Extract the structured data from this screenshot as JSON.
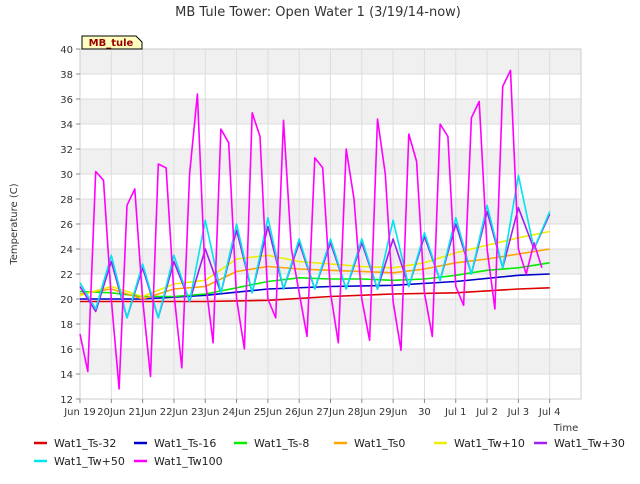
{
  "chart_data": {
    "type": "line",
    "title": "MB Tule Tower: Open Water 1 (3/19/14-now)",
    "xlabel": "Time",
    "ylabel": "Temperature (C)",
    "site_label": "MB_tule",
    "xlim": [
      "2014-06-18T12:00",
      "2014-07-04T12:00"
    ],
    "ylim": [
      12,
      40
    ],
    "yticks": [
      12,
      14,
      16,
      18,
      20,
      22,
      24,
      26,
      28,
      30,
      32,
      34,
      36,
      38,
      40
    ],
    "xticks": [
      {
        "date": "2014-06-18T12:00",
        "label": "Jun 19"
      },
      {
        "date": "2014-06-19T12:00",
        "label": "20Jun"
      },
      {
        "date": "2014-06-20T12:00",
        "label": "21Jun"
      },
      {
        "date": "2014-06-21T12:00",
        "label": "22Jun"
      },
      {
        "date": "2014-06-22T12:00",
        "label": "23Jun"
      },
      {
        "date": "2014-06-23T12:00",
        "label": "24Jun"
      },
      {
        "date": "2014-06-24T12:00",
        "label": "25Jun"
      },
      {
        "date": "2014-06-25T12:00",
        "label": "26Jun"
      },
      {
        "date": "2014-06-26T12:00",
        "label": "27Jun"
      },
      {
        "date": "2014-06-27T12:00",
        "label": "28Jun"
      },
      {
        "date": "2014-06-28T12:00",
        "label": "29Jun"
      },
      {
        "date": "2014-06-29T12:00",
        "label": "30"
      },
      {
        "date": "2014-06-30T12:00",
        "label": "Jul 1"
      },
      {
        "date": "2014-07-01T12:00",
        "label": "Jul 2"
      },
      {
        "date": "2014-07-02T12:00",
        "label": "Jul 3"
      },
      {
        "date": "2014-07-03T12:00",
        "label": "Jul 4"
      }
    ],
    "grid": true,
    "band_fill": "#f0f0f0",
    "legend_position": "bottom",
    "series": [
      {
        "name": "Wat1_Ts-32",
        "color": "#dd0000",
        "x": [
          "2014-06-18T12:00",
          "2014-06-20T12:00",
          "2014-06-22T12:00",
          "2014-06-24T12:00",
          "2014-06-26T12:00",
          "2014-06-28T12:00",
          "2014-06-30T12:00",
          "2014-07-02T12:00",
          "2014-07-03T12:00"
        ],
        "y": [
          19.8,
          19.8,
          19.8,
          19.9,
          20.2,
          20.4,
          20.5,
          20.8,
          20.9
        ]
      },
      {
        "name": "Wat1_Ts-16",
        "color": "#0000cc",
        "x": [
          "2014-06-18T12:00",
          "2014-06-20T12:00",
          "2014-06-22T12:00",
          "2014-06-24T12:00",
          "2014-06-26T12:00",
          "2014-06-28T12:00",
          "2014-06-30T12:00",
          "2014-07-02T12:00",
          "2014-07-03T12:00"
        ],
        "y": [
          20.0,
          20.0,
          20.3,
          20.8,
          21.0,
          21.1,
          21.4,
          21.9,
          22.0
        ]
      },
      {
        "name": "Wat1_Ts-8",
        "color": "#00ee00",
        "x": [
          "2014-06-18T12:00",
          "2014-06-19T12:00",
          "2014-06-20T12:00",
          "2014-06-21T12:00",
          "2014-06-22T12:00",
          "2014-06-23T12:00",
          "2014-06-24T12:00",
          "2014-06-25T12:00",
          "2014-06-26T12:00",
          "2014-06-27T12:00",
          "2014-06-28T12:00",
          "2014-06-29T12:00",
          "2014-06-30T12:00",
          "2014-07-01T12:00",
          "2014-07-02T12:00",
          "2014-07-03T12:00"
        ],
        "y": [
          20.6,
          20.5,
          20.2,
          20.2,
          20.4,
          20.9,
          21.4,
          21.7,
          21.6,
          21.6,
          21.5,
          21.6,
          21.9,
          22.3,
          22.5,
          22.9
        ]
      },
      {
        "name": "Wat1_Ts0",
        "color": "#ffa500",
        "x": [
          "2014-06-18T12:00",
          "2014-06-19T12:00",
          "2014-06-20T12:00",
          "2014-06-21T12:00",
          "2014-06-22T12:00",
          "2014-06-23T12:00",
          "2014-06-24T12:00",
          "2014-06-25T12:00",
          "2014-06-26T12:00",
          "2014-06-27T12:00",
          "2014-06-28T12:00",
          "2014-06-29T12:00",
          "2014-06-30T12:00",
          "2014-07-01T12:00",
          "2014-07-02T12:00",
          "2014-07-03T12:00"
        ],
        "y": [
          20.4,
          20.8,
          20.0,
          20.8,
          21.0,
          22.2,
          22.6,
          22.4,
          22.3,
          22.2,
          22.1,
          22.4,
          22.9,
          23.2,
          23.6,
          24.0
        ]
      },
      {
        "name": "Wat1_Tw+10",
        "color": "#eeee00",
        "x": [
          "2014-06-18T12:00",
          "2014-06-19T12:00",
          "2014-06-20T12:00",
          "2014-06-21T12:00",
          "2014-06-22T12:00",
          "2014-06-23T12:00",
          "2014-06-24T12:00",
          "2014-06-25T12:00",
          "2014-06-26T12:00",
          "2014-06-27T12:00",
          "2014-06-28T12:00",
          "2014-06-29T12:00",
          "2014-06-30T12:00",
          "2014-07-01T12:00",
          "2014-07-02T12:00",
          "2014-07-03T12:00"
        ],
        "y": [
          20.3,
          21.0,
          20.2,
          21.2,
          21.5,
          23.2,
          23.5,
          23.0,
          22.8,
          22.6,
          22.5,
          22.9,
          23.7,
          24.3,
          24.9,
          25.4
        ]
      },
      {
        "name": "Wat1_Tw+30",
        "color": "#a020f0",
        "x": [
          "2014-06-18T12:00",
          "2014-06-19T00:00",
          "2014-06-19T12:00",
          "2014-06-20T00:00",
          "2014-06-20T12:00",
          "2014-06-21T00:00",
          "2014-06-21T12:00",
          "2014-06-22T00:00",
          "2014-06-22T12:00",
          "2014-06-23T00:00",
          "2014-06-23T12:00",
          "2014-06-24T00:00",
          "2014-06-24T12:00",
          "2014-06-25T00:00",
          "2014-06-25T12:00",
          "2014-06-26T00:00",
          "2014-06-26T12:00",
          "2014-06-27T00:00",
          "2014-06-27T12:00",
          "2014-06-28T00:00",
          "2014-06-28T12:00",
          "2014-06-29T00:00",
          "2014-06-29T12:00",
          "2014-06-30T00:00",
          "2014-06-30T12:00",
          "2014-07-01T00:00",
          "2014-07-01T12:00",
          "2014-07-02T00:00",
          "2014-07-02T12:00",
          "2014-07-03T00:00",
          "2014-07-03T12:00"
        ],
        "y": [
          21.0,
          19.0,
          23.0,
          18.5,
          22.5,
          18.5,
          23.0,
          19.8,
          24.0,
          20.5,
          25.5,
          20.5,
          25.8,
          20.8,
          24.5,
          20.8,
          24.5,
          20.8,
          24.5,
          20.8,
          24.8,
          21.0,
          25.0,
          21.5,
          26.0,
          22.0,
          27.0,
          22.5,
          27.3,
          24.0,
          26.8
        ]
      },
      {
        "name": "Wat1_Tw+50",
        "color": "#00e5ee",
        "x": [
          "2014-06-18T12:00",
          "2014-06-19T00:00",
          "2014-06-19T12:00",
          "2014-06-20T00:00",
          "2014-06-20T12:00",
          "2014-06-21T00:00",
          "2014-06-21T12:00",
          "2014-06-22T00:00",
          "2014-06-22T12:00",
          "2014-06-23T00:00",
          "2014-06-23T12:00",
          "2014-06-24T00:00",
          "2014-06-24T12:00",
          "2014-06-25T00:00",
          "2014-06-25T12:00",
          "2014-06-26T00:00",
          "2014-06-26T12:00",
          "2014-06-27T00:00",
          "2014-06-27T12:00",
          "2014-06-28T00:00",
          "2014-06-28T12:00",
          "2014-06-29T00:00",
          "2014-06-29T12:00",
          "2014-06-30T00:00",
          "2014-06-30T12:00",
          "2014-07-01T00:00",
          "2014-07-01T12:00",
          "2014-07-02T00:00",
          "2014-07-02T12:00",
          "2014-07-03T00:00",
          "2014-07-03T12:00"
        ],
        "y": [
          21.3,
          19.2,
          23.5,
          18.5,
          22.8,
          18.5,
          23.5,
          19.8,
          26.3,
          20.5,
          26.0,
          20.5,
          26.5,
          20.8,
          24.8,
          20.8,
          24.8,
          20.8,
          24.8,
          20.8,
          26.3,
          21.0,
          25.3,
          21.5,
          26.5,
          22.0,
          27.5,
          22.5,
          29.9,
          24.0,
          27.0
        ]
      },
      {
        "name": "Wat1_Tw100",
        "color": "#ff00ff",
        "x": [
          "2014-06-18T12:00",
          "2014-06-18T18:00",
          "2014-06-19T00:00",
          "2014-06-19T06:00",
          "2014-06-19T12:00",
          "2014-06-19T18:00",
          "2014-06-20T00:00",
          "2014-06-20T06:00",
          "2014-06-20T12:00",
          "2014-06-20T18:00",
          "2014-06-21T00:00",
          "2014-06-21T06:00",
          "2014-06-21T12:00",
          "2014-06-21T18:00",
          "2014-06-22T00:00",
          "2014-06-22T06:00",
          "2014-06-22T12:00",
          "2014-06-22T18:00",
          "2014-06-23T00:00",
          "2014-06-23T06:00",
          "2014-06-23T12:00",
          "2014-06-23T18:00",
          "2014-06-24T00:00",
          "2014-06-24T06:00",
          "2014-06-24T12:00",
          "2014-06-24T18:00",
          "2014-06-25T00:00",
          "2014-06-25T06:00",
          "2014-06-25T12:00",
          "2014-06-25T18:00",
          "2014-06-26T00:00",
          "2014-06-26T06:00",
          "2014-06-26T12:00",
          "2014-06-26T18:00",
          "2014-06-27T00:00",
          "2014-06-27T06:00",
          "2014-06-27T12:00",
          "2014-06-27T18:00",
          "2014-06-28T00:00",
          "2014-06-28T06:00",
          "2014-06-28T12:00",
          "2014-06-28T18:00",
          "2014-06-29T00:00",
          "2014-06-29T06:00",
          "2014-06-29T12:00",
          "2014-06-29T18:00",
          "2014-06-30T00:00",
          "2014-06-30T06:00",
          "2014-06-30T12:00",
          "2014-06-30T18:00",
          "2014-07-01T00:00",
          "2014-07-01T06:00",
          "2014-07-01T12:00",
          "2014-07-01T18:00",
          "2014-07-02T00:00",
          "2014-07-02T06:00",
          "2014-07-02T12:00",
          "2014-07-02T18:00",
          "2014-07-03T00:00",
          "2014-07-03T06:00"
        ],
        "y": [
          17.2,
          14.2,
          30.2,
          29.5,
          20.0,
          12.8,
          27.5,
          28.8,
          20.0,
          13.8,
          30.8,
          30.5,
          20.5,
          14.5,
          30.0,
          36.4,
          21.5,
          16.5,
          33.6,
          32.5,
          20.0,
          16.0,
          34.9,
          33.0,
          20.0,
          18.5,
          34.3,
          24.0,
          20.5,
          17.0,
          31.3,
          30.5,
          20.5,
          16.5,
          32.0,
          28.0,
          20.0,
          16.7,
          34.4,
          30.0,
          19.8,
          15.9,
          33.2,
          31.0,
          20.5,
          17.0,
          34.0,
          33.0,
          21.0,
          19.5,
          34.5,
          35.8,
          24.0,
          19.2,
          37.0,
          38.3,
          24.0,
          22.0,
          24.5,
          22.5
        ]
      }
    ]
  }
}
